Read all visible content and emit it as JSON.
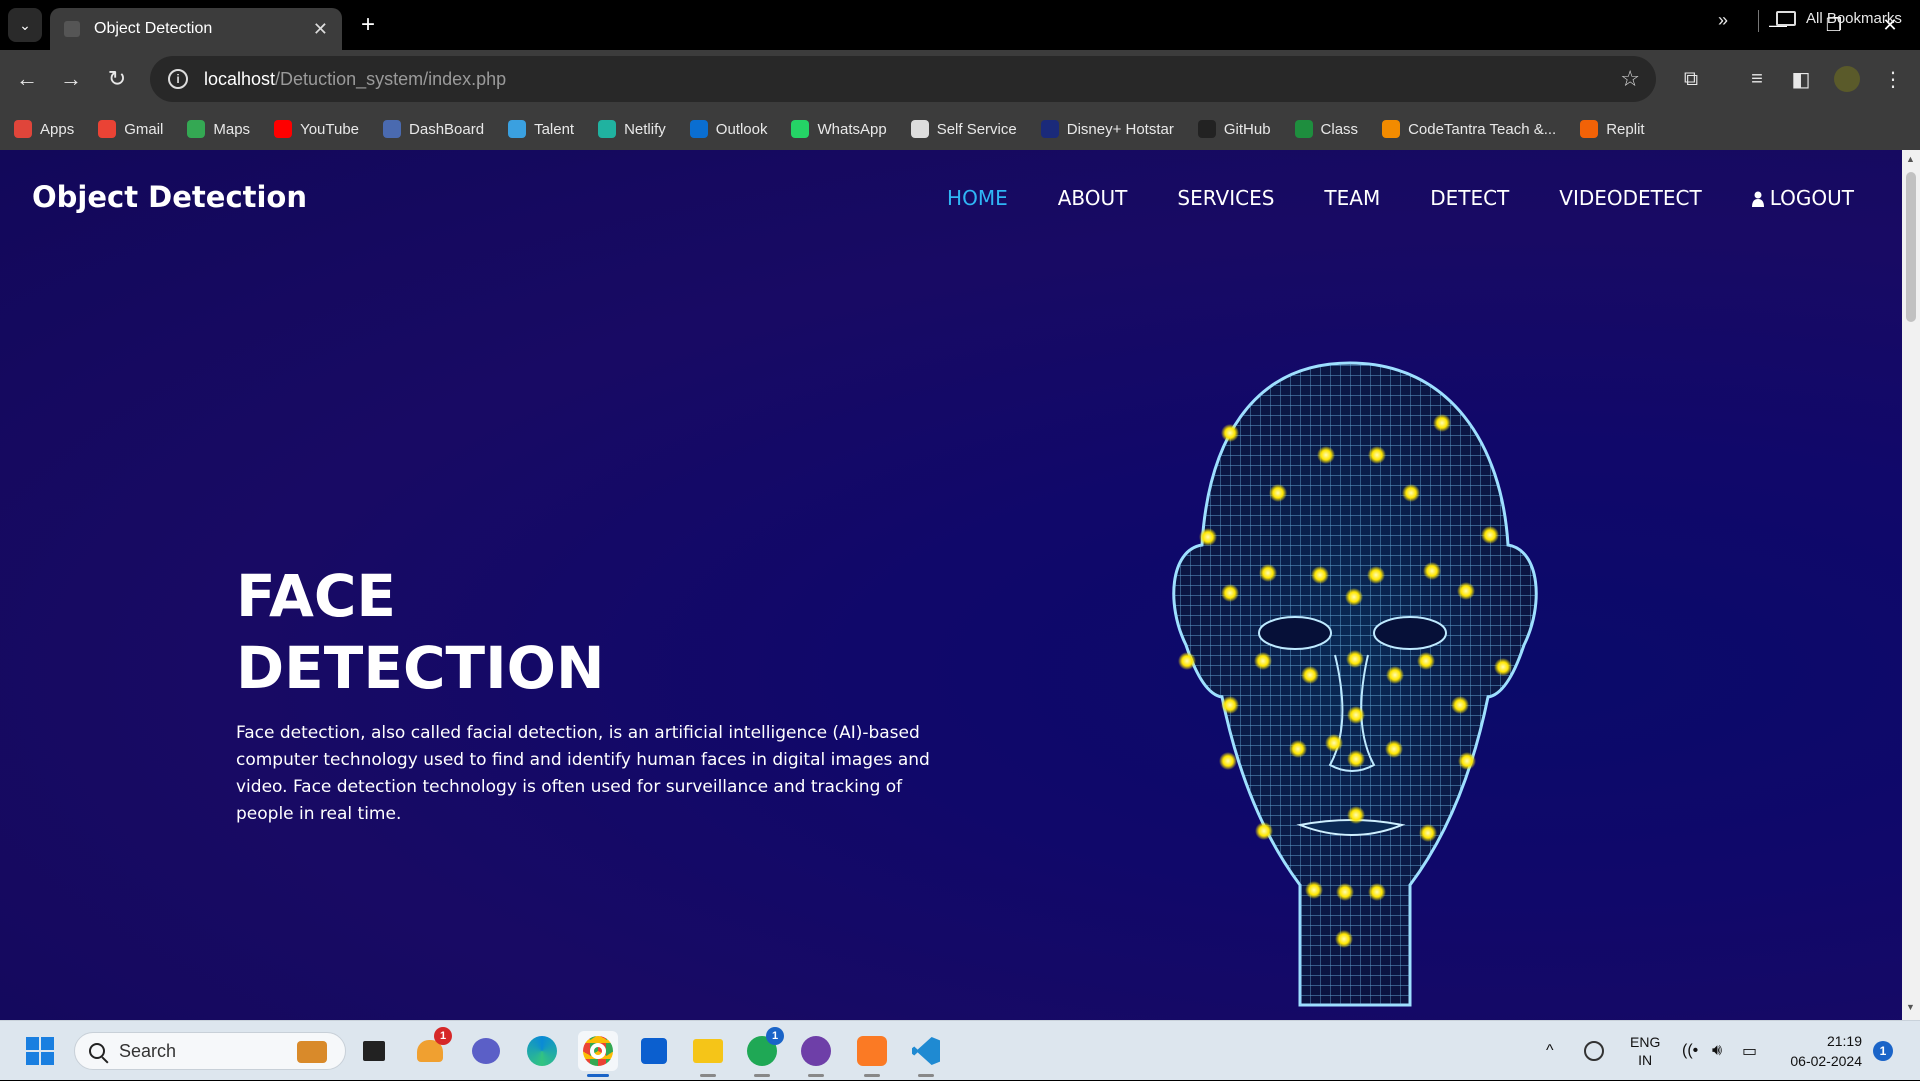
{
  "browser": {
    "tab_title": "Object Detection",
    "tab_close": "✕",
    "new_tab": "+",
    "window_controls": {
      "minimize": "—",
      "restore": "❐",
      "close": "✕"
    },
    "url_host": "localhost",
    "url_path": "/Detuction_system/index.php",
    "bookmarks": [
      {
        "label": "Apps",
        "color": "#e0453a"
      },
      {
        "label": "Gmail",
        "color": "#ea4335"
      },
      {
        "label": "Maps",
        "color": "#34a853"
      },
      {
        "label": "YouTube",
        "color": "#ff0000"
      },
      {
        "label": "DashBoard",
        "color": "#4a6ab0"
      },
      {
        "label": "Talent",
        "color": "#3aa0e0"
      },
      {
        "label": "Netlify",
        "color": "#20b2a0"
      },
      {
        "label": "Outlook",
        "color": "#0a6ed1"
      },
      {
        "label": "WhatsApp",
        "color": "#25d366"
      },
      {
        "label": "Self Service",
        "color": "#dddddd"
      },
      {
        "label": "Disney+ Hotstar",
        "color": "#1a2a7a"
      },
      {
        "label": "GitHub",
        "color": "#222222"
      },
      {
        "label": "Class",
        "color": "#1e8e3e"
      },
      {
        "label": "CodeTantra Teach &...",
        "color": "#f28b00"
      },
      {
        "label": "Replit",
        "color": "#f26207"
      }
    ],
    "bookmarks_more": "»",
    "all_bookmarks": "All Bookmarks"
  },
  "site": {
    "brand": "Object Detection",
    "nav": {
      "home": "HOME",
      "about": "ABOUT",
      "services": "SERVICES",
      "team": "TEAM",
      "detect": "DETECT",
      "videodetect": "VIDEODETECT",
      "logout": "LOGOUT"
    },
    "hero": {
      "title_line1": "FACE",
      "title_line2": "DETECTION",
      "description": "Face detection, also called facial detection, is an artificial intelligence (AI)-based computer technology used to find and identify human faces in digital images and video. Face detection technology is often used for surveillance and tracking of people in real time."
    },
    "accent_color": "#2fb6f5"
  },
  "taskbar": {
    "search_placeholder": "Search",
    "badges": {
      "app1": "1",
      "whatsapp": "1"
    },
    "language": "ENG",
    "region": "IN",
    "time": "21:19",
    "date": "06-02-2024",
    "notification_count": "1"
  }
}
